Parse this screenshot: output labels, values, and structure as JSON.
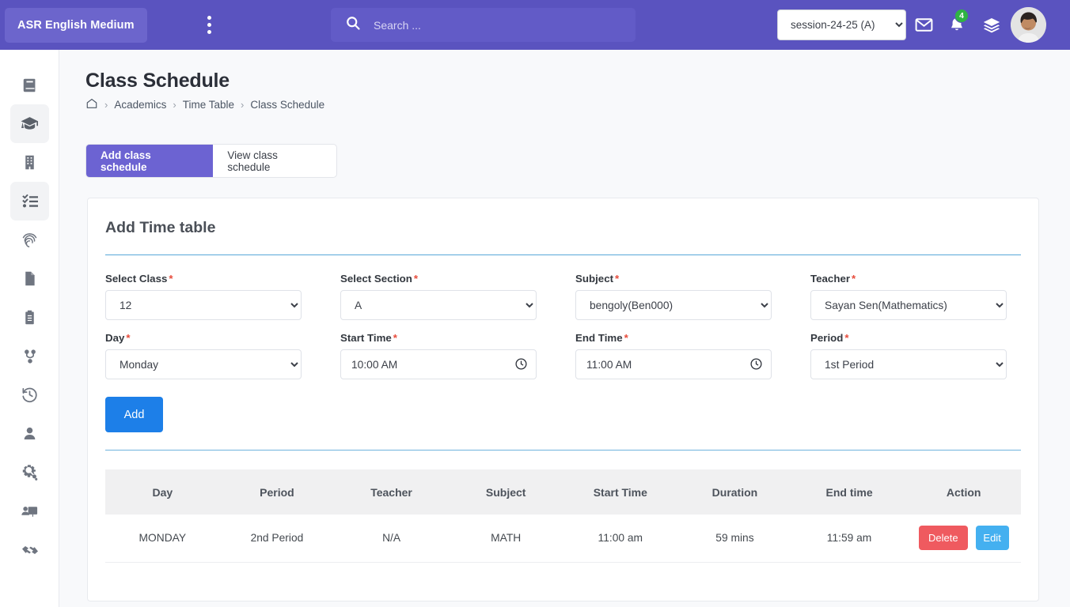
{
  "header": {
    "brand": "ASR English Medium",
    "menu_icon": "kebab-menu-icon",
    "search": {
      "placeholder": "Search ...",
      "value": ""
    },
    "session": {
      "selected": "session-24-25 (A)",
      "options": [
        "session-24-25 (A)"
      ]
    },
    "mail_icon": "envelope-icon",
    "bell_icon": "bell-icon",
    "notification_count": "4",
    "layers_icon": "layers-icon",
    "avatar": "user-avatar"
  },
  "sidebar": {
    "items": [
      {
        "icon": "book-icon",
        "active": false
      },
      {
        "icon": "graduation-cap-icon",
        "active": true
      },
      {
        "icon": "building-icon",
        "active": false
      },
      {
        "icon": "checklist-icon",
        "active": true
      },
      {
        "icon": "fingerprint-icon",
        "active": false
      },
      {
        "icon": "file-icon",
        "active": false
      },
      {
        "icon": "clipboard-icon",
        "active": false
      },
      {
        "icon": "git-branch-icon",
        "active": false
      },
      {
        "icon": "history-icon",
        "active": false
      },
      {
        "icon": "user-icon",
        "active": false
      },
      {
        "icon": "gears-icon",
        "active": false
      },
      {
        "icon": "presentation-user-icon",
        "active": false
      },
      {
        "icon": "handshake-icon",
        "active": false
      }
    ]
  },
  "page": {
    "title": "Class Schedule",
    "breadcrumb": {
      "home_icon": "home-icon",
      "items": [
        "Academics",
        "Time Table",
        "Class Schedule"
      ],
      "separator": "›"
    }
  },
  "tabs": [
    {
      "label": "Add class schedule",
      "active": true
    },
    {
      "label": "View class schedule",
      "active": false
    }
  ],
  "form": {
    "title": "Add Time table",
    "required_mark": "*",
    "fields": {
      "select_class": {
        "label": "Select Class",
        "value": "12",
        "options": [
          "12"
        ]
      },
      "select_section": {
        "label": "Select Section",
        "value": "A",
        "options": [
          "A"
        ]
      },
      "subject": {
        "label": "Subject",
        "value": "bengoly(Ben000)",
        "options": [
          "bengoly(Ben000)"
        ]
      },
      "teacher": {
        "label": "Teacher",
        "value": "Sayan Sen(Mathematics)",
        "options": [
          "Sayan Sen(Mathematics)"
        ]
      },
      "day": {
        "label": "Day",
        "value": "Monday",
        "options": [
          "Monday"
        ]
      },
      "start_time": {
        "label": "Start Time",
        "value": "10:00 AM",
        "icon": "clock-icon"
      },
      "end_time": {
        "label": "End Time",
        "value": "11:00 AM",
        "icon": "clock-icon"
      },
      "period": {
        "label": "Period",
        "value": "1st Period",
        "options": [
          "1st Period"
        ]
      }
    },
    "submit_label": "Add"
  },
  "table": {
    "columns": [
      "Day",
      "Period",
      "Teacher",
      "Subject",
      "Start Time",
      "Duration",
      "End time",
      "Action"
    ],
    "rows": [
      {
        "day": "MONDAY",
        "period": "2nd Period",
        "teacher": "N/A",
        "subject": "MATH",
        "start_time": "11:00 am",
        "duration": "59 mins",
        "end_time": "11:59 am",
        "delete_label": "Delete",
        "edit_label": "Edit"
      }
    ]
  },
  "colors": {
    "header_purple": "#5a53bf",
    "tab_purple": "#6c63d2",
    "add_blue": "#1d7fe8",
    "delete_red": "#ef5a5f",
    "edit_blue": "#44b0f0",
    "badge_green": "#2fb344",
    "required_red": "#e74c3c",
    "rule_blue": "#58a8d8"
  }
}
